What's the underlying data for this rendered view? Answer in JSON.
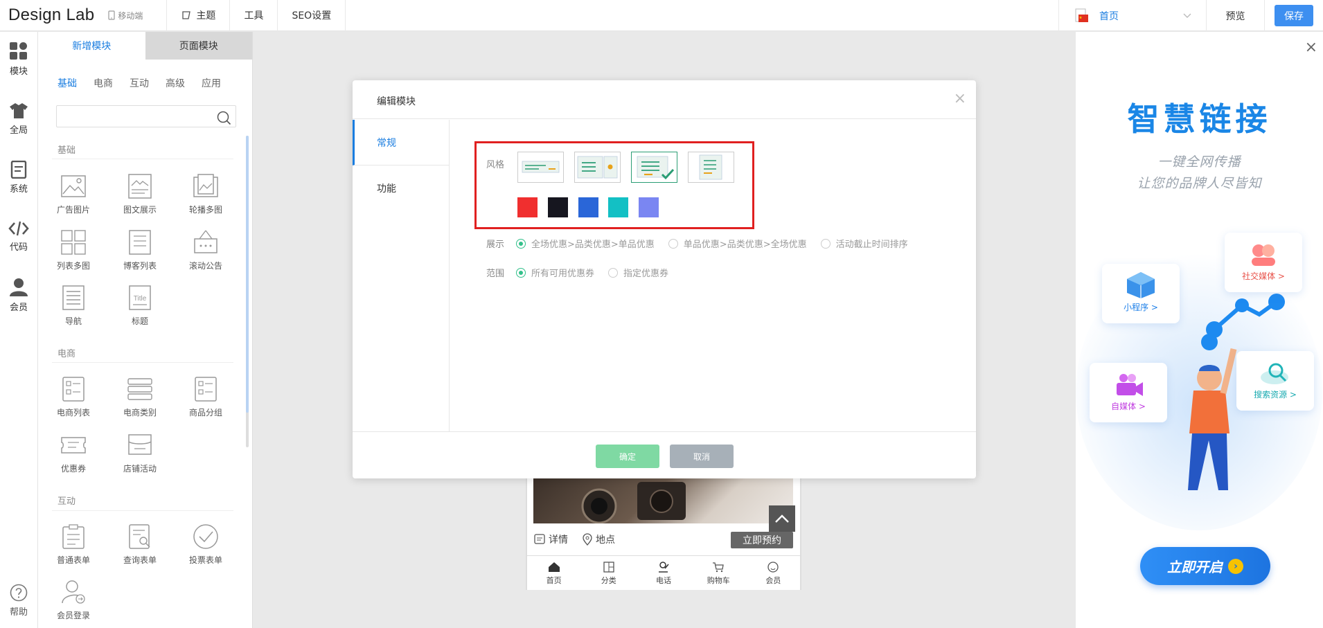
{
  "app": {
    "brand": "Design Lab",
    "device_label": "移动端"
  },
  "top_menu": [
    {
      "label": "主题",
      "icon": "theme-icon"
    },
    {
      "label": "工具",
      "icon": ""
    },
    {
      "label": "SEO设置",
      "icon": ""
    }
  ],
  "top_right": {
    "language_page": "首页",
    "preview_label": "预览",
    "save_label": "保存"
  },
  "rail": [
    {
      "label": "模块",
      "icon": "grid-icon"
    },
    {
      "label": "全局",
      "icon": "shirt-icon"
    },
    {
      "label": "系统",
      "icon": "doc-icon"
    },
    {
      "label": "代码",
      "icon": "code-icon"
    },
    {
      "label": "会员",
      "icon": "user-icon"
    }
  ],
  "help_label": "帮助",
  "panel": {
    "tabs": [
      "新增模块",
      "页面模块"
    ],
    "subtabs": [
      "基础",
      "电商",
      "互动",
      "高级",
      "应用"
    ],
    "search_placeholder": "",
    "sections": [
      {
        "title": "基础",
        "items": [
          "广告图片",
          "图文展示",
          "轮播多图",
          "列表多图",
          "博客列表",
          "滚动公告",
          "导航",
          "标题"
        ]
      },
      {
        "title": "电商",
        "items": [
          "电商列表",
          "电商类别",
          "商品分组",
          "优惠券",
          "店铺活动"
        ]
      },
      {
        "title": "互动",
        "items": [
          "普通表单",
          "查询表单",
          "投票表单",
          "会员登录"
        ]
      }
    ]
  },
  "canvas": {
    "detail_label": "详情",
    "location_label": "地点",
    "book_label": "立即预约",
    "tabbar": [
      "首页",
      "分类",
      "电话",
      "购物车",
      "会员"
    ]
  },
  "modal": {
    "title": "编辑模块",
    "side_tabs": [
      "常规",
      "功能"
    ],
    "style_label": "风格",
    "selected_style_index": 2,
    "colors": [
      "#f02f2f",
      "#16161f",
      "#2a66d8",
      "#13c0c4",
      "#7a86f2"
    ],
    "display_label": "展示",
    "display_options": [
      "全场优惠>品类优惠>单品优惠",
      "单品优惠>品类优惠>全场优惠",
      "活动截止时间排序"
    ],
    "display_selected": 0,
    "scope_label": "范围",
    "scope_options": [
      "所有可用优惠券",
      "指定优惠券"
    ],
    "scope_selected": 0,
    "ok_label": "确定",
    "cancel_label": "取消"
  },
  "promo": {
    "title": "智慧链接",
    "sub1": "一键全网传播",
    "sub2": "让您的品牌人尽皆知",
    "cards": [
      "小程序 >",
      "社交媒体 >",
      "自媒体 >",
      "搜索资源 >"
    ],
    "button": "立即开启"
  }
}
